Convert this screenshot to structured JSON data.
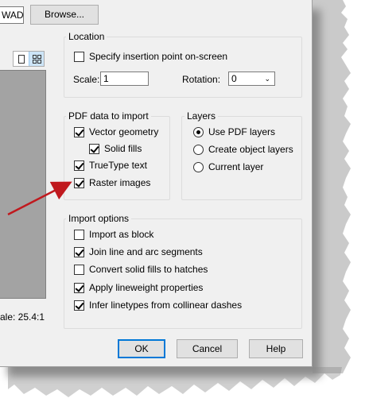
{
  "top": {
    "file_fragment": "WAD",
    "browse_label": "Browse...",
    "scale_readout": "ale: 25.4:1"
  },
  "location": {
    "title": "Location",
    "specify_insertion": {
      "label": "Specify insertion point on-screen",
      "checked": false
    },
    "scale_label": "Scale:",
    "scale_value": "1",
    "rotation_label": "Rotation:",
    "rotation_value": "0"
  },
  "pdf_data": {
    "title": "PDF data to import",
    "items": [
      {
        "label": "Vector geometry",
        "checked": true
      },
      {
        "label": "Solid fills",
        "checked": true
      },
      {
        "label": "TrueType text",
        "checked": true
      },
      {
        "label": "Raster images",
        "checked": true
      }
    ]
  },
  "layers": {
    "title": "Layers",
    "options": [
      {
        "label": "Use PDF layers",
        "selected": true
      },
      {
        "label": "Create object layers",
        "selected": false
      },
      {
        "label": "Current layer",
        "selected": false
      }
    ]
  },
  "import_options": {
    "title": "Import options",
    "items": [
      {
        "label": "Import as block",
        "checked": false
      },
      {
        "label": "Join line and arc segments",
        "checked": true
      },
      {
        "label": "Convert solid fills to hatches",
        "checked": false
      },
      {
        "label": "Apply lineweight properties",
        "checked": true
      },
      {
        "label": "Infer linetypes from collinear dashes",
        "checked": true
      }
    ]
  },
  "footer": {
    "ok_label": "OK",
    "cancel_label": "Cancel",
    "help_label": "Help"
  },
  "colors": {
    "dialog_bg": "#f0f0f0",
    "preview_gray": "#a3a3a3",
    "arrow_red": "#c0191e",
    "default_button_border": "#0078d7"
  },
  "icons": [
    "single-page-view-icon",
    "thumbnail-grid-view-icon",
    "chevron-down-icon",
    "annotation-arrow"
  ]
}
